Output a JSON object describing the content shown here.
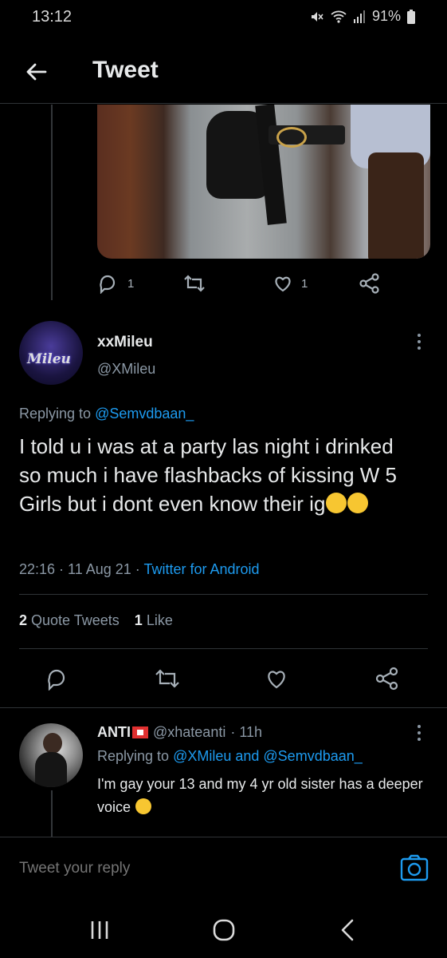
{
  "status_bar": {
    "time": "13:12",
    "battery": "91%"
  },
  "header": {
    "title": "Tweet"
  },
  "previous_tweet": {
    "reply_count": "1",
    "like_count": "1"
  },
  "main_tweet": {
    "display_name": "xxMileu",
    "handle": "@XMileu",
    "avatar_text": "Mileu",
    "replying_label": "Replying to",
    "replying_to": "@Semvdbaan_",
    "text": "I told u i was at a party las night i drinked so much i have flashbacks of kissing W 5 Girls but i dont even know their ig",
    "timestamp": "22:16 · 11 Aug 21 ·",
    "client": "Twitter for Android",
    "quote_count": "2",
    "quote_label": "Quote Tweets",
    "like_count": "1",
    "like_label": "Like"
  },
  "reply_tweet": {
    "display_name": "ANTI",
    "handle": "@xhateanti",
    "time": "· 11h",
    "replying_label": "Replying to",
    "replying_to": "@XMileu and @Semvdbaan_",
    "text": "I'm gay your 13 and my 4 yr old sister has a deeper voice"
  },
  "compose": {
    "placeholder": "Tweet your reply"
  },
  "colors": {
    "background": "#000000",
    "link": "#1d9bf0",
    "muted": "#8b98a5",
    "text": "#e7e9ea"
  },
  "icons": [
    "back-arrow-icon",
    "mute-icon",
    "wifi-icon",
    "signal-icon",
    "battery-icon",
    "reply-icon",
    "retweet-icon",
    "like-icon",
    "share-icon",
    "more-icon",
    "camera-icon",
    "recents-icon",
    "home-icon",
    "back-nav-icon"
  ]
}
